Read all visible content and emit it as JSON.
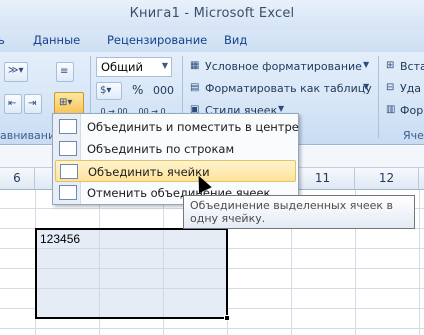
{
  "window": {
    "title": "Книга1 - Microsoft Excel"
  },
  "menu_tabs": [
    "ь",
    "Данные",
    "Рецензирование",
    "Вид"
  ],
  "ribbon": {
    "number_format": "Общий",
    "percent_symbol": "%",
    "thousands_symbol": "000",
    "dec_increase": ",0 →,00",
    "dec_decrease": ",00 →,0",
    "styles": {
      "conditional": "Условное форматирование",
      "format_table": "Форматировать как таблицу",
      "cell_styles": "Стили ячеек"
    },
    "cells": {
      "insert": "Вста",
      "delete": "Уда",
      "format": "Фор"
    },
    "group_labels": {
      "alignment": "авнивание",
      "cells": "Яче"
    }
  },
  "columns": [
    "6",
    "11",
    "12"
  ],
  "merge_menu": {
    "items": [
      "Объединить и поместить в центре",
      "Объединить по строкам",
      "Объединить ячейки",
      "Отменить объединение ячеек"
    ],
    "hovered_index": 2
  },
  "tooltip": "Объединение выделенных ячеек в одну ячейку.",
  "cell_value": "123456",
  "colors": {
    "accent": "#f8c55a",
    "selection_border": "#000000"
  }
}
